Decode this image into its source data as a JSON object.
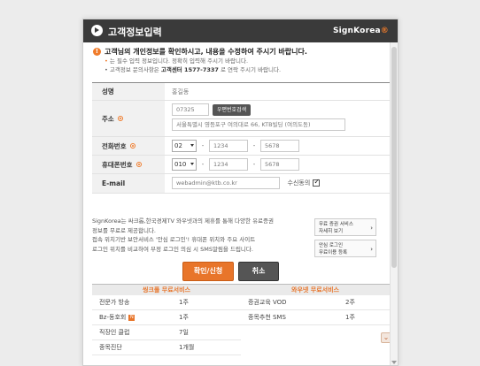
{
  "titlebar": {
    "title": "고객정보입력",
    "logo": "SignKorea",
    "logo_dot": "®"
  },
  "notice": {
    "main": "고객님의 개인정보를 확인하시고, 내용을 수정하여 주시기 바랍니다.",
    "sub1_a": "•",
    "sub1_b": "는 필수 입력 정보입니다. 정확히 입력해 주시기 바랍니다.",
    "sub2_a": "• 고객정보 문의사항은 ",
    "sub2_b": "고객센터 1577-7337",
    "sub2_c": " 로 연락 주시기 바랍니다."
  },
  "form": {
    "name_label": "성명",
    "name_value": "홍길동",
    "address_label": "주소",
    "zip_value": "07325",
    "zip_button": "우편번호검색",
    "address_value": "서울특별시 영등포구 여의대로 66, KTB빌딩 (여의도동)",
    "phone_label": "전화번호",
    "phone_area": "02",
    "phone_mid": "1234",
    "phone_last": "5678",
    "mobile_label": "휴대폰번호",
    "mobile_prefix": "010",
    "mobile_mid": "1234",
    "mobile_last": "5678",
    "dash": "-",
    "email_label": "E-mail",
    "email_value": "webadmin@ktb.co.kr",
    "receive_label": "수신동의"
  },
  "info": {
    "line1": "SignKorea는 싸크롭,한국경제TV 와우넷과의 제휴를 통해 다양한 유료증권",
    "line2": "정보를 무료로 제공합니다.",
    "line3": "접속 위치기반 보안서비스 '안심 로그인'! 휴대폰 위치와 주요 사이트",
    "line4": "로그인 위치를 비교하여 부정 로그인 의심 시 SMS알림을 드립니다."
  },
  "side_buttons": [
    {
      "line1": "무료 증권 서비스",
      "line2": "자세히 보기"
    },
    {
      "line1": "안심 로그인",
      "line2": "무료이용 등록"
    }
  ],
  "buttons": {
    "confirm": "확인/신청",
    "cancel": "취소"
  },
  "services": {
    "left_head": "씽크풀 무료서비스",
    "right_head": "와우넷 무료서비스",
    "left_items": [
      {
        "name": "전문가 방송",
        "period": "1주"
      },
      {
        "name": "Bz-동호회",
        "period": "1주",
        "badge": "N"
      },
      {
        "name": "직장인 클럽",
        "period": "7일"
      },
      {
        "name": "종목진단",
        "period": "1개월"
      }
    ],
    "right_items": [
      {
        "name": "증권교육 VOD",
        "period": "2주"
      },
      {
        "name": "종목추천 SMS",
        "period": "1주"
      }
    ]
  },
  "colors": {
    "accent": "#e8752a",
    "titlebar": "#3a3a3a"
  },
  "icons": [
    "back-arrow-icon",
    "alert-icon",
    "required-mark-icon",
    "checkbox-checked-icon",
    "chevron-right-icon",
    "scroll-up-icon"
  ]
}
